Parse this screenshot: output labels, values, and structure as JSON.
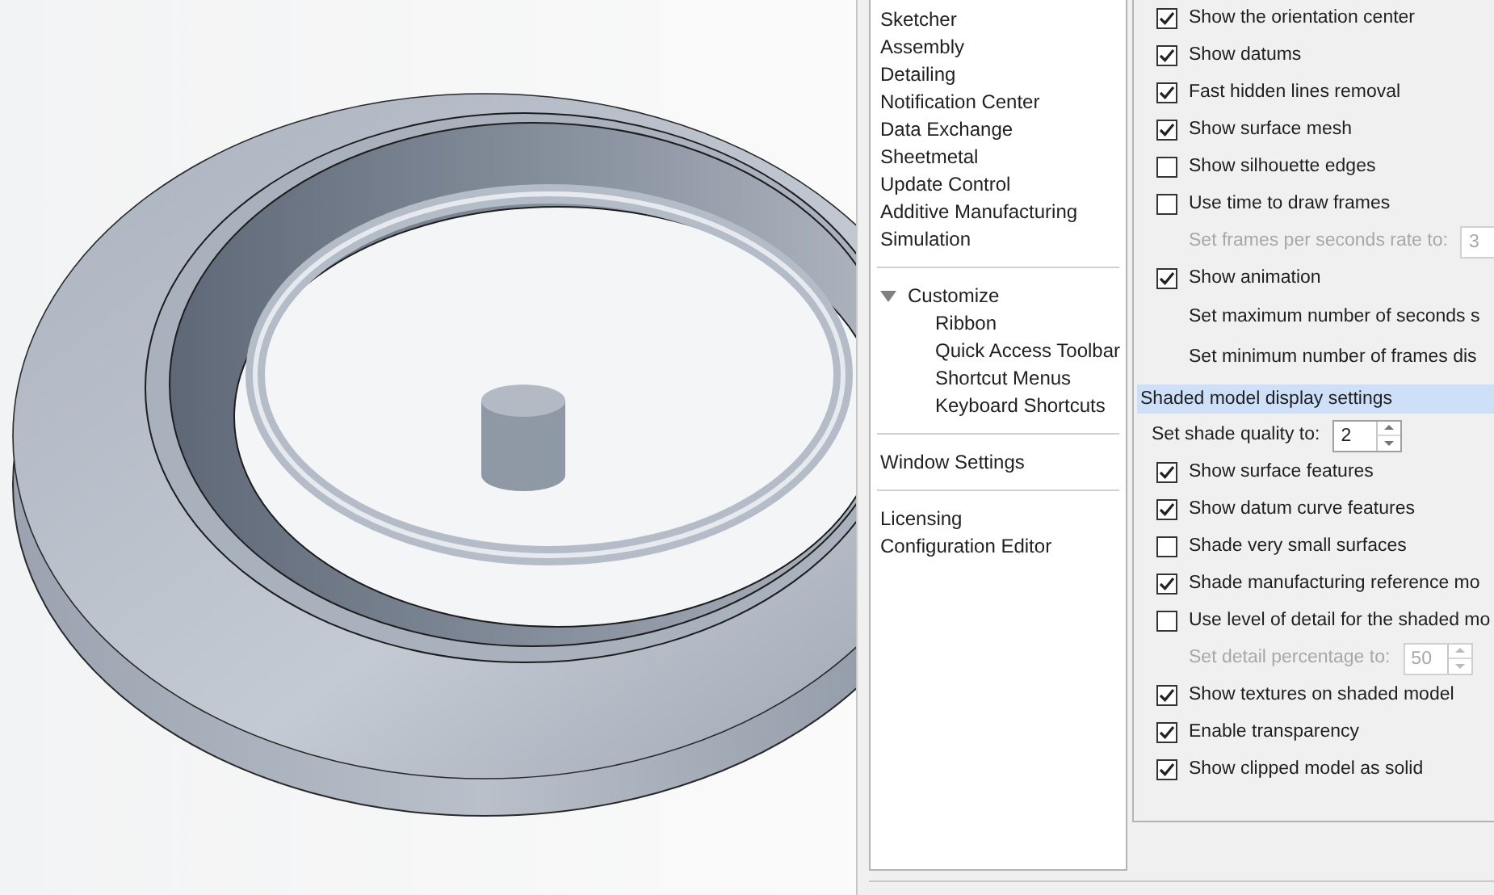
{
  "sidebar": {
    "groups": [
      {
        "items": [
          {
            "label": "Sketcher"
          },
          {
            "label": "Assembly"
          },
          {
            "label": "Detailing"
          },
          {
            "label": "Notification Center"
          },
          {
            "label": "Data Exchange"
          },
          {
            "label": "Sheetmetal"
          },
          {
            "label": "Update Control"
          },
          {
            "label": "Additive Manufacturing"
          },
          {
            "label": "Simulation"
          }
        ]
      },
      {
        "items": [
          {
            "label": "Customize",
            "expanded": true,
            "children": [
              {
                "label": "Ribbon"
              },
              {
                "label": "Quick Access Toolbar"
              },
              {
                "label": "Shortcut Menus"
              },
              {
                "label": "Keyboard Shortcuts"
              }
            ]
          }
        ]
      },
      {
        "items": [
          {
            "label": "Window Settings"
          }
        ]
      },
      {
        "items": [
          {
            "label": "Licensing"
          },
          {
            "label": "Configuration Editor"
          }
        ]
      }
    ]
  },
  "settings": [
    {
      "kind": "checkbox",
      "label": "Show the orientation center",
      "checked": true
    },
    {
      "kind": "checkbox",
      "label": "Show datums",
      "checked": true
    },
    {
      "kind": "checkbox",
      "label": "Fast hidden lines removal",
      "checked": true
    },
    {
      "kind": "checkbox",
      "label": "Show surface mesh",
      "checked": true
    },
    {
      "kind": "checkbox",
      "label": "Show silhouette edges",
      "checked": false
    },
    {
      "kind": "checkbox",
      "label": "Use time to draw frames",
      "checked": false
    },
    {
      "kind": "spin",
      "label": "Set frames per seconds rate to:",
      "value": "3",
      "disabled": true
    },
    {
      "kind": "checkbox",
      "label": "Show animation",
      "checked": true
    },
    {
      "kind": "label",
      "label": "Set maximum number of seconds s"
    },
    {
      "kind": "label",
      "label": "Set minimum number of frames dis"
    },
    {
      "kind": "header",
      "label": "Shaded model display settings"
    },
    {
      "kind": "spin",
      "label": "Set shade quality to:",
      "value": "2",
      "disabled": false
    },
    {
      "kind": "checkbox",
      "label": "Show surface features",
      "checked": true
    },
    {
      "kind": "checkbox",
      "label": "Show datum curve features",
      "checked": true
    },
    {
      "kind": "checkbox",
      "label": "Shade very small surfaces",
      "checked": false
    },
    {
      "kind": "checkbox",
      "label": "Shade manufacturing reference mo",
      "checked": true
    },
    {
      "kind": "checkbox",
      "label": "Use level of detail for the shaded mo",
      "checked": false
    },
    {
      "kind": "spin",
      "label": "Set detail percentage to:",
      "value": "50",
      "disabled": true
    },
    {
      "kind": "checkbox",
      "label": "Show textures on shaded model",
      "checked": true
    },
    {
      "kind": "checkbox",
      "label": "Enable transparency",
      "checked": true
    },
    {
      "kind": "checkbox",
      "label": "Show clipped model as solid",
      "checked": true
    }
  ]
}
